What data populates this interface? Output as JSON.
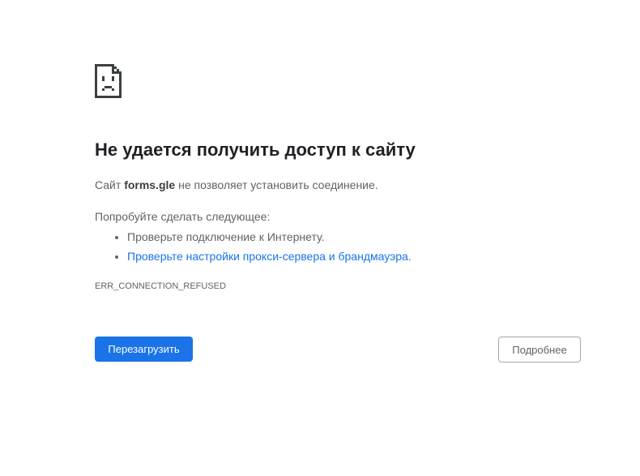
{
  "error": {
    "title": "Не удается получить доступ к сайту",
    "summary_prefix": "Сайт ",
    "host": "forms.gle",
    "summary_suffix": " не позволяет установить соединение.",
    "suggestions_heading": "Попробуйте сделать следующее:",
    "suggestions": [
      {
        "text": "Проверьте подключение к Интернету.",
        "is_link": false
      },
      {
        "text": "Проверьте настройки прокси-сервера и брандмауэра",
        "suffix": ".",
        "is_link": true
      }
    ],
    "code": "ERR_CONNECTION_REFUSED"
  },
  "buttons": {
    "reload_label": "Перезагрузить",
    "details_label": "Подробнее"
  },
  "icons": {
    "page_icon": "sad-page-icon"
  },
  "colors": {
    "primary": "#1a73e8",
    "link": "#1a73e8",
    "title_text": "#202124",
    "body_text": "#5f6368"
  }
}
